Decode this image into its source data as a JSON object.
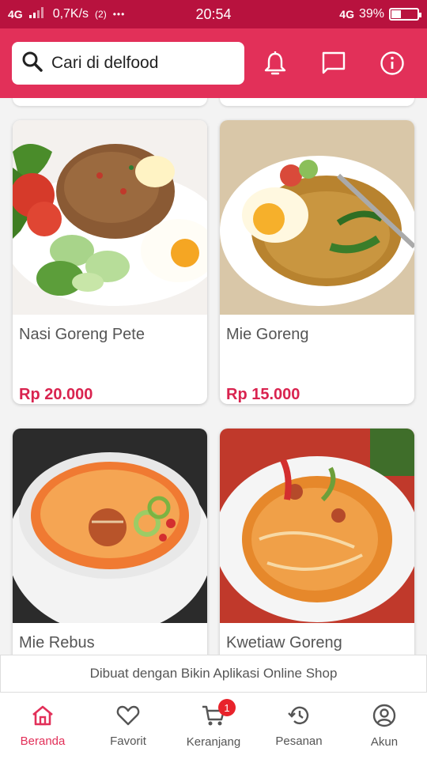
{
  "status_bar": {
    "network": "4G",
    "speed": "0,7K/s",
    "wifi_label": "2",
    "dots": "•••",
    "time": "20:54",
    "network_right": "4G",
    "battery_percent": "39%",
    "battery_level": 0.39
  },
  "header": {
    "search_placeholder": "Cari di delfood",
    "icons": [
      "bell-icon",
      "chat-icon",
      "info-icon"
    ]
  },
  "products": [
    {
      "name": "Nasi Goreng Pete",
      "price": "Rp 20.000"
    },
    {
      "name": "Mie Goreng",
      "price": "Rp 15.000"
    },
    {
      "name": "Mie Rebus",
      "price": ""
    },
    {
      "name": "Kwetiaw Goreng",
      "price": ""
    }
  ],
  "banner": {
    "text": "Dibuat dengan Bikin Aplikasi Online Shop"
  },
  "bottom_nav": {
    "items": [
      {
        "label": "Beranda",
        "icon": "home-icon",
        "active": true
      },
      {
        "label": "Favorit",
        "icon": "heart-icon"
      },
      {
        "label": "Keranjang",
        "icon": "cart-icon",
        "badge": "1"
      },
      {
        "label": "Pesanan",
        "icon": "history-icon"
      },
      {
        "label": "Akun",
        "icon": "account-icon"
      }
    ]
  },
  "colors": {
    "primary": "#e23059",
    "status_bar": "#b8123e",
    "price": "#d9234f",
    "badge": "#e8232b"
  }
}
